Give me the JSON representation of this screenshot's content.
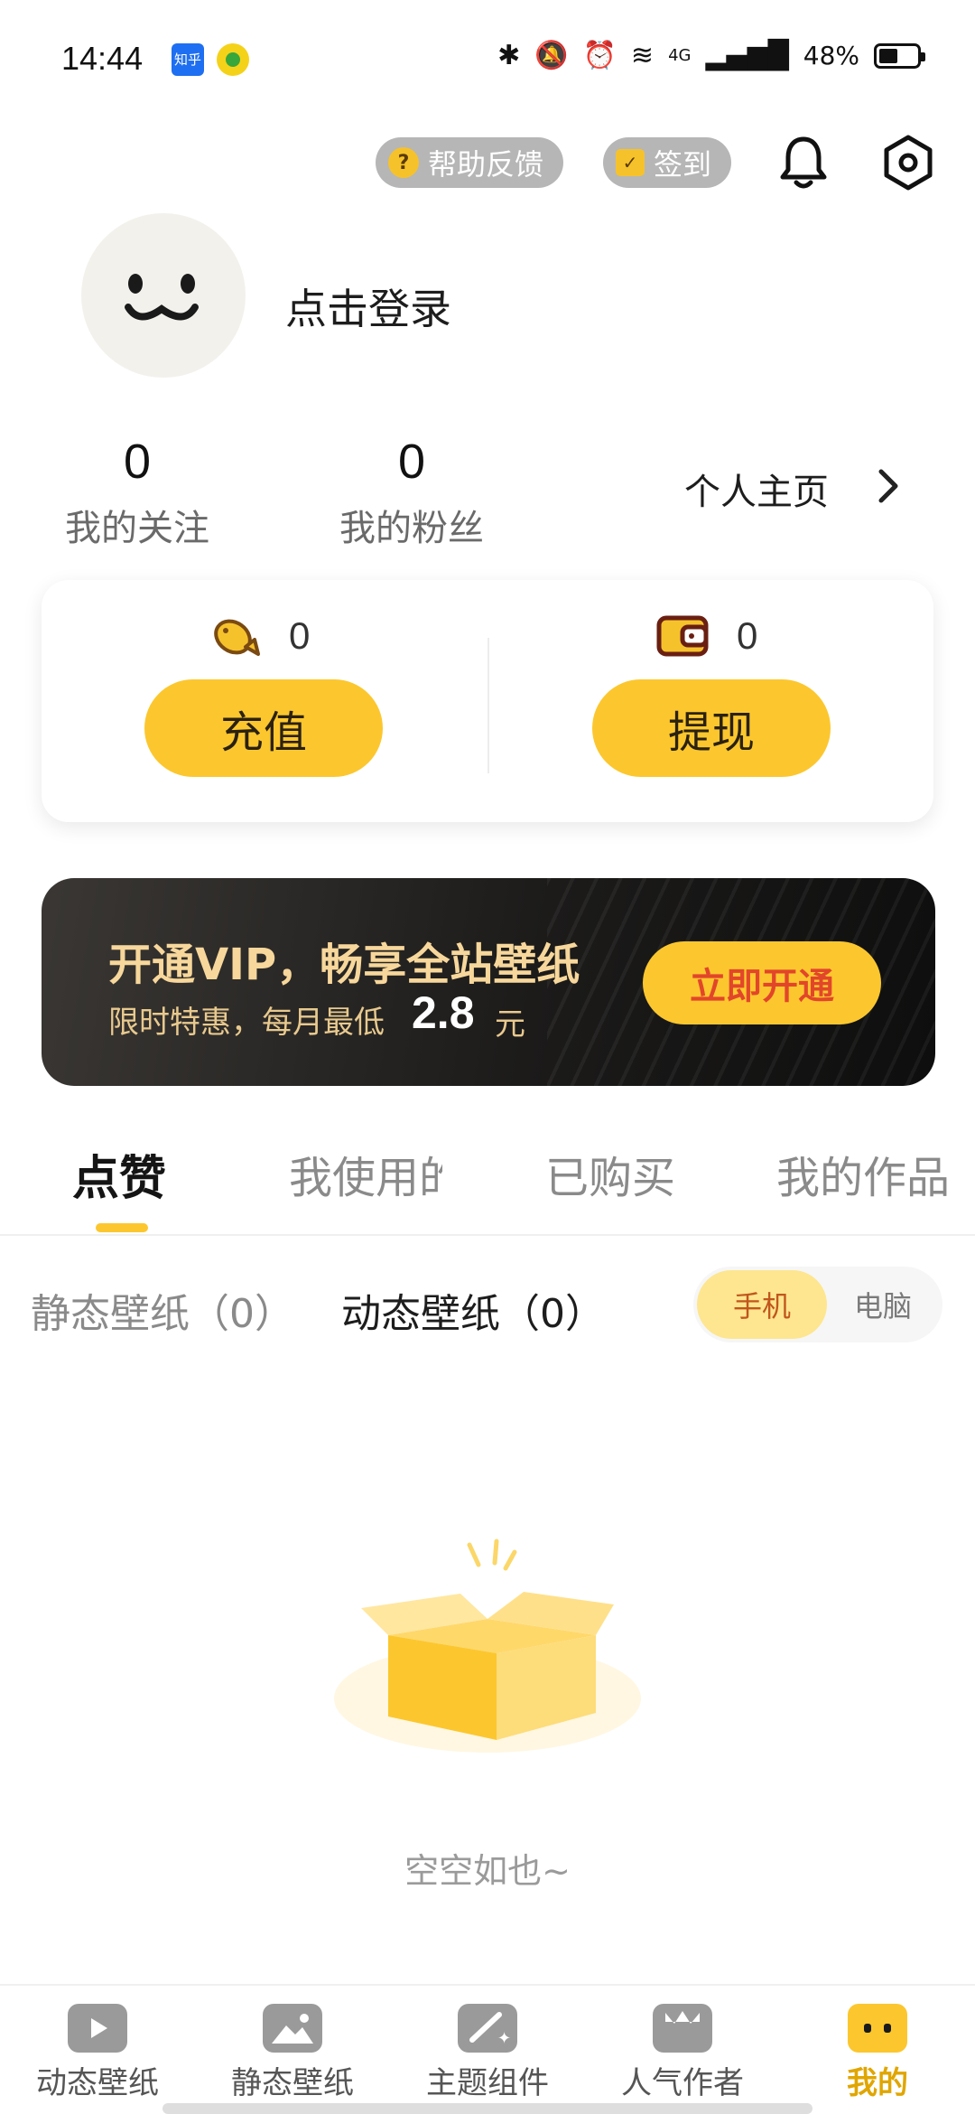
{
  "status_bar": {
    "time": "14:44",
    "app_icon_1": "知乎",
    "battery_percent": "48%",
    "network": "4G"
  },
  "header": {
    "help_label": "帮助反馈",
    "signin_label": "签到",
    "help_icon_glyph": "?"
  },
  "profile": {
    "login_text": "点击登录",
    "following_count": "0",
    "following_label": "我的关注",
    "fans_count": "0",
    "fans_label": "我的粉丝",
    "homepage_label": "个人主页"
  },
  "wallet": {
    "coins_value": "0",
    "recharge_label": "充值",
    "balance_value": "0",
    "withdraw_label": "提现"
  },
  "vip": {
    "title": "开通VIP，畅享全站壁纸",
    "subtitle": "限时特惠，每月最低",
    "price": "2.8",
    "unit": "元",
    "button_label": "立即开通"
  },
  "tabs": [
    {
      "label": "点赞",
      "active": true
    },
    {
      "label": "我使用的",
      "active": false
    },
    {
      "label": "已购买",
      "active": false
    },
    {
      "label": "我的作品",
      "active": false
    }
  ],
  "filters": {
    "static_label": "静态壁纸（0）",
    "dynamic_label": "动态壁纸（0）",
    "device_phone": "手机",
    "device_pc": "电脑"
  },
  "empty": {
    "text": "空空如也~"
  },
  "bottom_nav": [
    {
      "label": "动态壁纸",
      "icon": "tv-play-icon"
    },
    {
      "label": "静态壁纸",
      "icon": "image-icon"
    },
    {
      "label": "主题组件",
      "icon": "widget-icon"
    },
    {
      "label": "人气作者",
      "icon": "crown-icon"
    },
    {
      "label": "我的",
      "icon": "profile-face-icon",
      "active": true
    }
  ],
  "colors": {
    "accent": "#fcc72e",
    "vip_gold": "#f7d79b",
    "vip_button_text": "#e2462a",
    "active_nav": "#e0a600"
  }
}
